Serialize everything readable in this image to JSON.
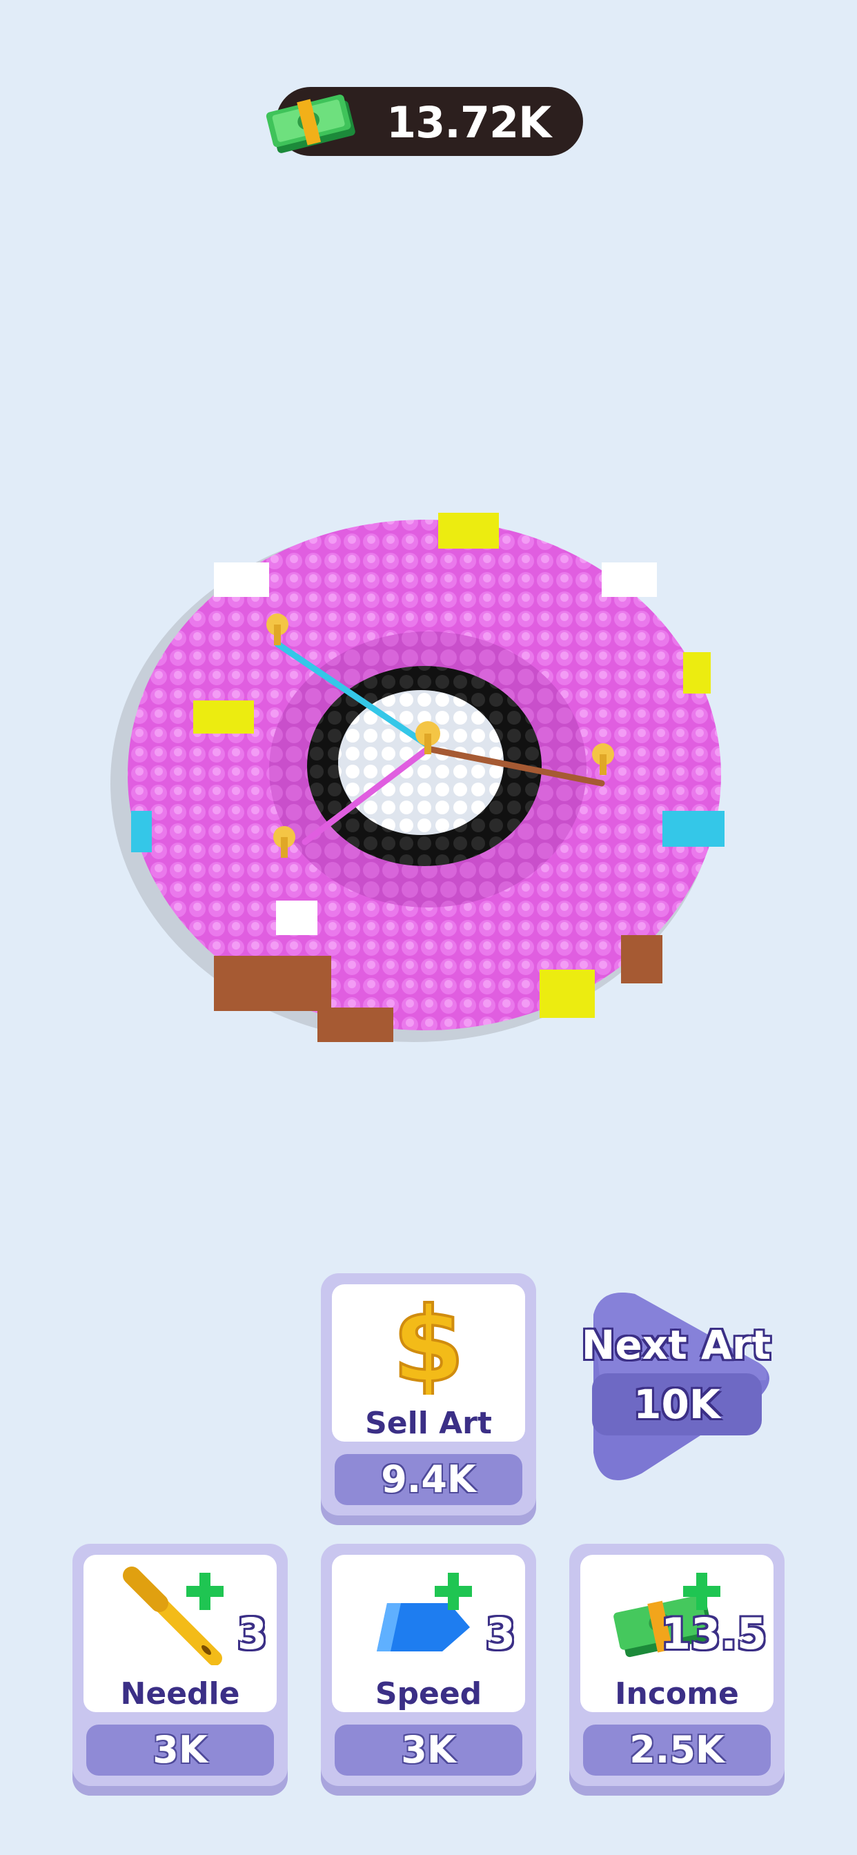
{
  "currency": {
    "amount": "13.72K",
    "icon": "cash-stack-icon"
  },
  "artwork": {
    "colors": {
      "pink": "#e05ee0",
      "yellow": "#ecec10",
      "white": "#ffffff",
      "black": "#1d1d1d",
      "cyan": "#34c7e8",
      "brown": "#a65a33"
    }
  },
  "sell_art": {
    "label": "Sell Art",
    "price": "9.4K",
    "icon": "dollar-sign-icon"
  },
  "next_art": {
    "label": "Next Art",
    "price": "10K"
  },
  "upgrades": [
    {
      "label": "Needle",
      "price": "3K",
      "level": "3",
      "icon": "needle-icon"
    },
    {
      "label": "Speed",
      "price": "3K",
      "level": "3",
      "icon": "speed-arrow-icon"
    },
    {
      "label": "Income",
      "price": "2.5K",
      "level": "13.5",
      "icon": "cash-stack-icon"
    }
  ],
  "theme": {
    "card_bg": "#c9c6ef",
    "price_bg": "#8f8ad6",
    "label_color": "#3b2f86",
    "background": "#e1ecf8"
  }
}
